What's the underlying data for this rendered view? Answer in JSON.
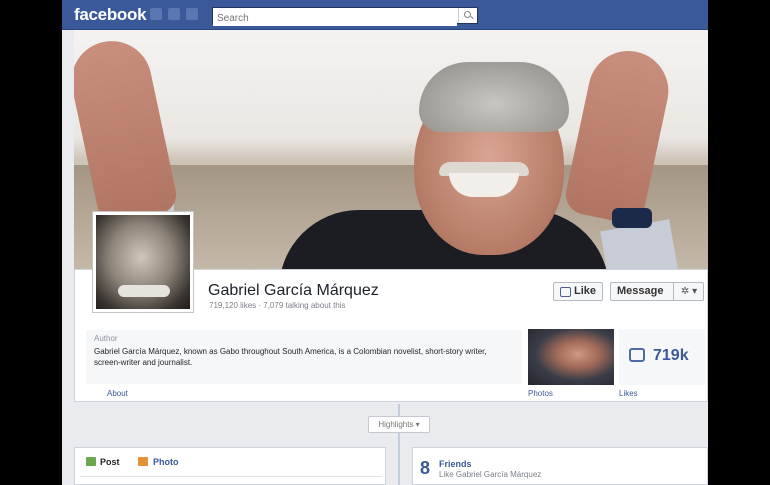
{
  "topbar": {
    "logo": "facebook",
    "search_placeholder": "Search"
  },
  "profile": {
    "name": "Gabriel García Márquez",
    "stats": "719,120 likes · 7,079 talking about this",
    "like_button": "Like",
    "message_button": "Message",
    "settings_glyph": "✲ ▾"
  },
  "about": {
    "label": "Author",
    "text": "Gabriel García Márquez, known as Gabo throughout South America, is a Colombian novelist, short-story writer, screen-writer and journalist."
  },
  "likes_box": {
    "count": "719k"
  },
  "tabs": {
    "about": "About",
    "photos": "Photos",
    "likes": "Likes"
  },
  "timeline": {
    "highlights": "Highlights ▾"
  },
  "composer": {
    "post": "Post",
    "photo": "Photo"
  },
  "friends": {
    "count": "8",
    "label": "Friends",
    "sub": "Like Gabriel García Márquez"
  },
  "colors": {
    "brand": "#3b5998",
    "page_bg": "#e9ebee"
  }
}
